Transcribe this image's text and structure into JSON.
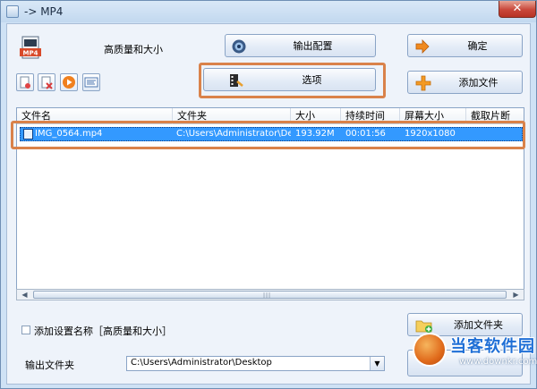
{
  "window": {
    "title": "-> MP4",
    "close_glyph": "✕"
  },
  "preset": {
    "label": "高质量和大小",
    "icon": "mp4-file-icon"
  },
  "buttons": {
    "output_config": "输出配置",
    "ok": "确定",
    "options": "选项",
    "add_file": "添加文件",
    "add_folder": "添加文件夹"
  },
  "toolbar_icons": [
    "remove-icon",
    "clear-icon",
    "play-icon",
    "info-icon"
  ],
  "table": {
    "columns": [
      "文件名",
      "文件夹",
      "大小",
      "持续时间",
      "屏幕大小",
      "截取片断"
    ],
    "rows": [
      {
        "name": "IMG_0564.mp4",
        "folder": "C:\\Users\\Administrator\\Des...",
        "size": "193.92M",
        "duration": "00:01:56",
        "resolution": "1920x1080",
        "clip": ""
      }
    ]
  },
  "checkbox": {
    "label": "添加设置名称［高质量和大小］",
    "checked": false
  },
  "output": {
    "label": "输出文件夹",
    "path": "C:\\Users\\Administrator\\Desktop"
  },
  "watermark": {
    "text": "当客软件园",
    "url": "www.downkr.com"
  },
  "colors": {
    "highlight": "#d9824a",
    "selection": "#3399ff"
  }
}
